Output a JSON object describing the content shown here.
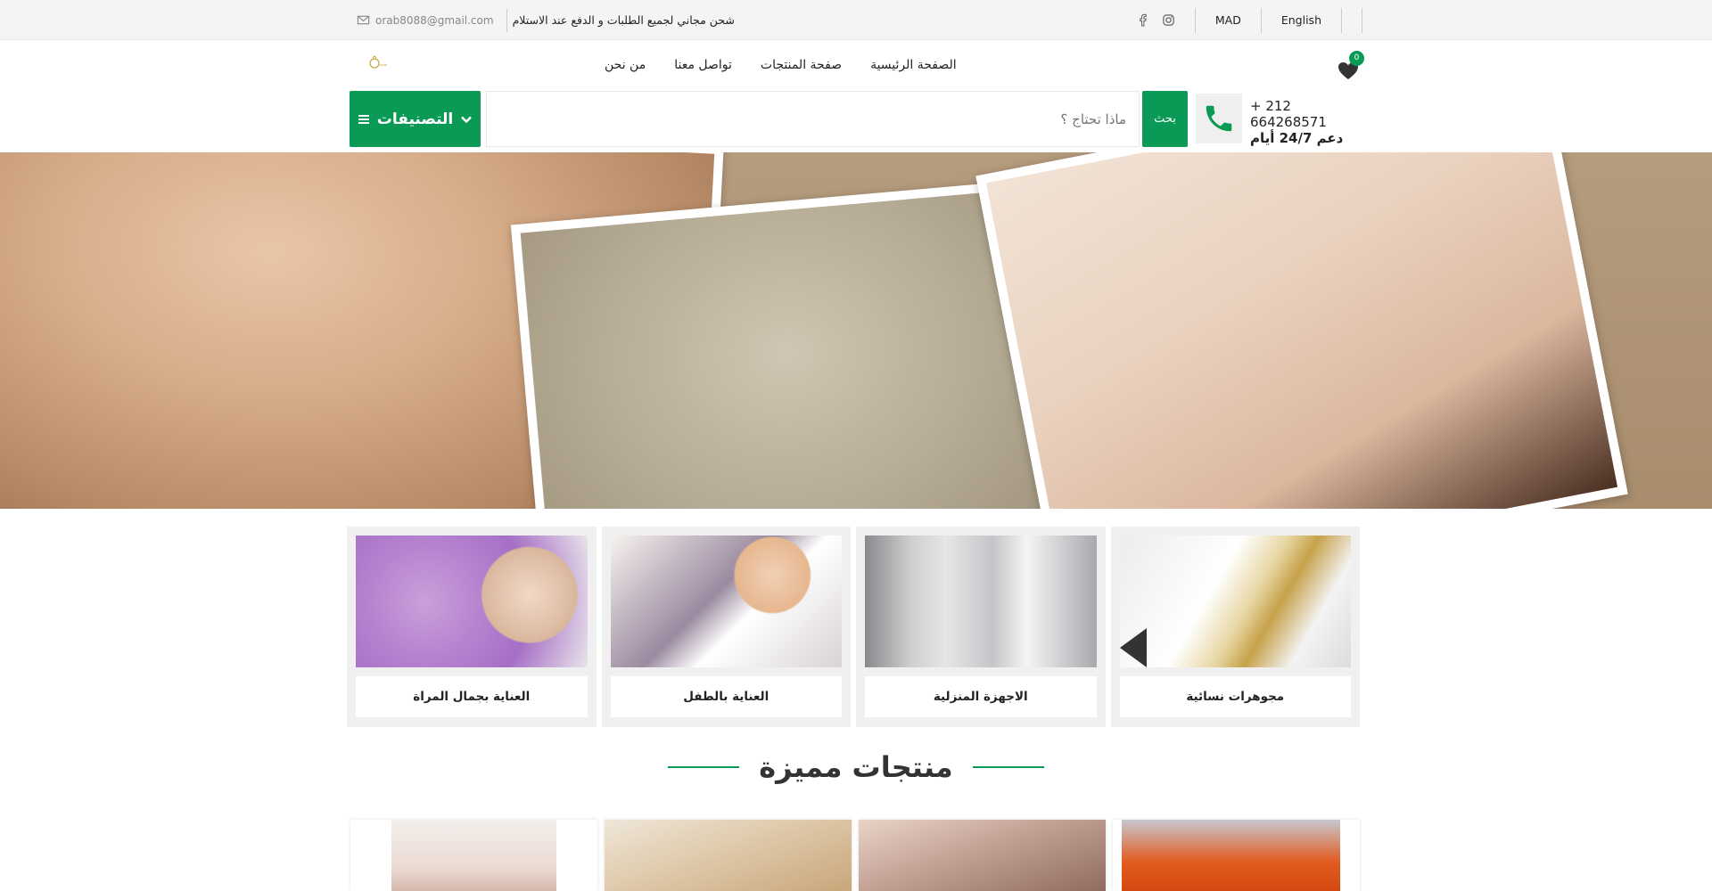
{
  "topbar": {
    "email": "orab8088@gmail.com",
    "shipping": "شحن مجاني لجميع الطلبات و الدفع عند الاستلام",
    "currency": "MAD",
    "language": "English"
  },
  "nav": {
    "items": [
      "من نحن",
      "تواصل معنا",
      "صفحة المنتجات",
      "الصفحة الرئيسية"
    ]
  },
  "wishlist": {
    "count": "0"
  },
  "search": {
    "categories_label": "التصنيفات",
    "placeholder": "ماذا تحتاج ؟",
    "button": "بحث"
  },
  "contact": {
    "phone": "+ 212 664268571",
    "support": "دعم 24/7 أيام"
  },
  "categories": [
    {
      "label": "العناية بجمال المراة"
    },
    {
      "label": "العناية بالطفل"
    },
    {
      "label": "الاجهزة المنزلية"
    },
    {
      "label": "مجوهرات نسائية"
    }
  ],
  "featured": {
    "title": "منتجات مميزة"
  },
  "colors": {
    "accent": "#0a9a55"
  }
}
